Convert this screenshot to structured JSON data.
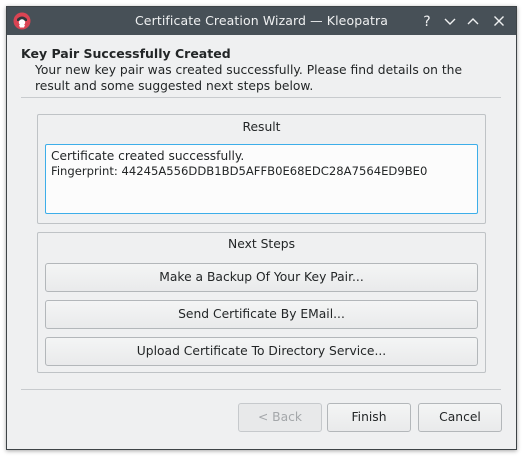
{
  "window": {
    "title": "Certificate Creation Wizard — Kleopatra"
  },
  "header": {
    "title": "Key Pair Successfully Created",
    "subtitle": "Your new key pair was created successfully. Please find details on the result and some suggested next steps below."
  },
  "result": {
    "title": "Result",
    "line1": "Certificate created successfully.",
    "line2": "Fingerprint: 44245A556DDB1BD5AFFB0E68EDC28A7564ED9BE0"
  },
  "next_steps": {
    "title": "Next Steps",
    "buttons": [
      "Make a Backup Of Your Key Pair...",
      "Send Certificate By EMail...",
      "Upload Certificate To Directory Service..."
    ]
  },
  "footer": {
    "back_label": "< Back",
    "finish_label": "Finish",
    "cancel_label": "Cancel"
  },
  "colors": {
    "titlebar": "#475057",
    "accent": "#3daee9",
    "app_icon": "#da4453"
  },
  "icons": [
    "kleopatra-app-icon",
    "help-icon",
    "minimize-icon",
    "maximize-icon",
    "close-icon"
  ]
}
